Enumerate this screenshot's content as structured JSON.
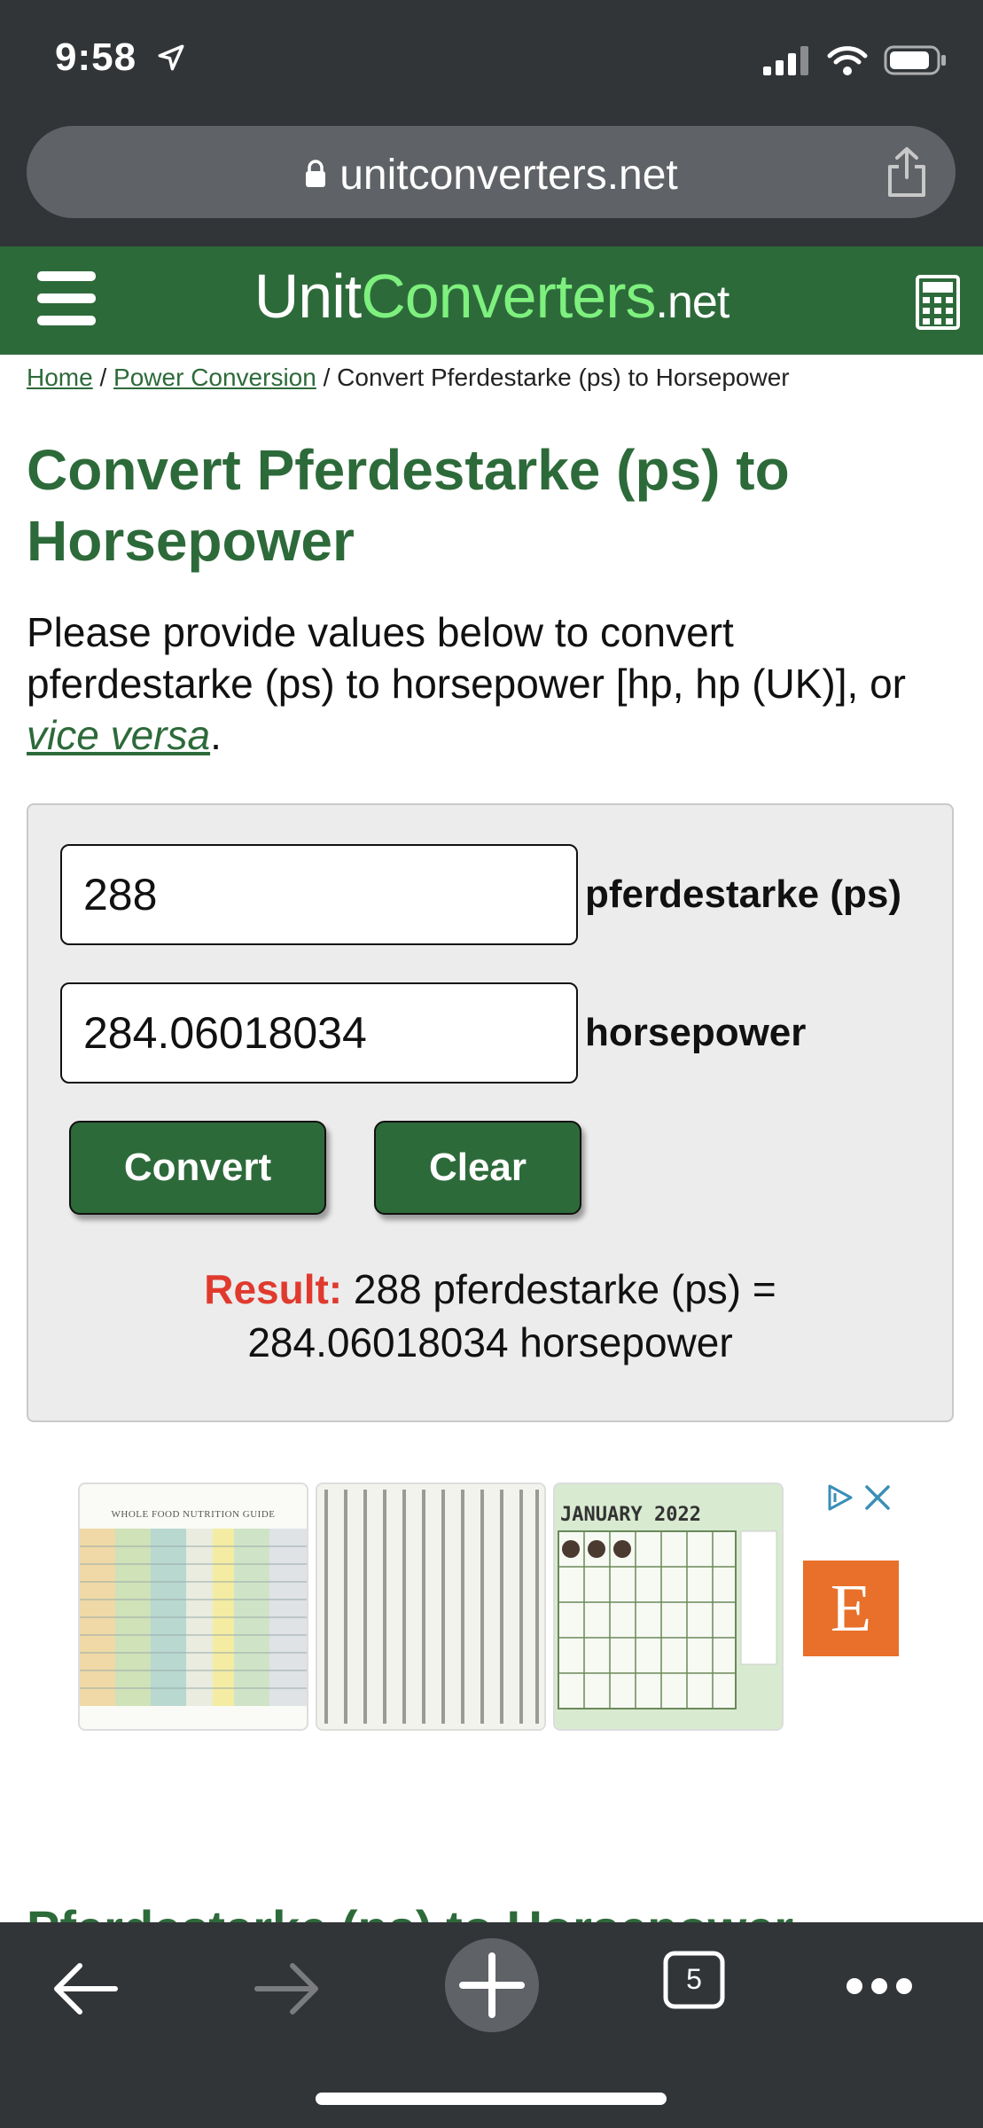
{
  "status_bar": {
    "time": "9:58"
  },
  "browser": {
    "url": "unitconverters.net",
    "tab_count": "5"
  },
  "site": {
    "brand_part1": "Unit",
    "brand_part2": "Converters",
    "brand_part3": ".net"
  },
  "breadcrumb": {
    "home": "Home",
    "sep1": " / ",
    "category": "Power Conversion",
    "sep2": " / ",
    "current": "Convert Pferdestarke (ps) to Horsepower"
  },
  "page": {
    "title": "Convert Pferdestarke (ps) to Horsepower",
    "intro_text": "Please provide values below to convert pferdestarke (ps) to horsepower [hp, hp (UK)], or ",
    "intro_link": "vice versa",
    "intro_end": "."
  },
  "converter": {
    "from_value": "288",
    "from_unit": "pferdestarke (ps)",
    "to_value": "284.06018034",
    "to_unit": "horsepower",
    "convert_label": "Convert",
    "clear_label": "Clear",
    "result_label": "Result:",
    "result_line1": " 288 pferdestarke (ps) =",
    "result_line2": "284.06018034 horsepower"
  },
  "ad": {
    "thumb1_title": "WHOLE FOOD NUTRITION GUIDE",
    "thumb3_title": "JANUARY 2022",
    "etsy_letter": "E"
  },
  "next_section_heading": "Pferdestarke (ps) to Horsepower",
  "colors": {
    "brand_green": "#2d6a3a",
    "accent_light_green": "#7ef07e",
    "result_red": "#e03a2e",
    "chrome_dark": "#323538"
  }
}
